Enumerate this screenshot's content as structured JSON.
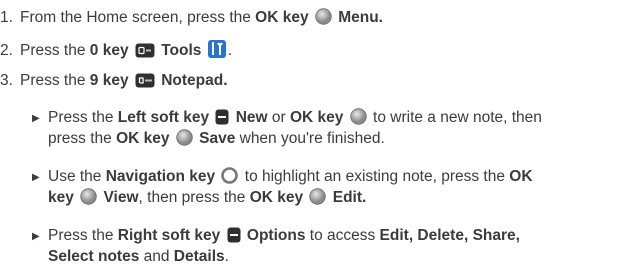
{
  "steps": [
    {
      "num": "1.",
      "pre": "From the Home screen, press the ",
      "key": "OK key",
      "post": "Menu."
    },
    {
      "num": "2.",
      "pre": "Press the ",
      "key": "0 key",
      "post": "Tools"
    },
    {
      "num": "3.",
      "pre": "Press the ",
      "key": "9 key",
      "post": "Notepad."
    }
  ],
  "bullets": [
    {
      "l1a": "Press the ",
      "l1k1": "Left soft key",
      "l1b": "New",
      "l1c": " or ",
      "l1k2": "OK key",
      "l1d": " to write a new note, then",
      "l2a": "press the ",
      "l2k": "OK key",
      "l2b": "Save",
      "l2c": " when you're finished."
    },
    {
      "l1a": "Use the ",
      "l1k": "Navigation key",
      "l1b": " to highlight an existing note, press the ",
      "l1k2": "OK",
      "l2k": "key",
      "l2a": "View",
      "l2b": ", then press the ",
      "l2k2": "OK key",
      "l2c": "Edit."
    },
    {
      "l1a": "Press the ",
      "l1k": "Right soft key",
      "l1b": "Options",
      "l1c": " to access ",
      "l1k2": "Edit, Delete, Share,",
      "l2k": "Select notes",
      "l2a": " and ",
      "l2k2": "Details",
      "l2b": "."
    }
  ],
  "icons": {
    "ok_key": "ok-key-icon",
    "zero_key": "zero-key-icon",
    "tools": "tools-icon",
    "nine_key": "nine-key-icon",
    "soft_key": "soft-key-icon",
    "nav_key": "navigation-key-icon"
  }
}
